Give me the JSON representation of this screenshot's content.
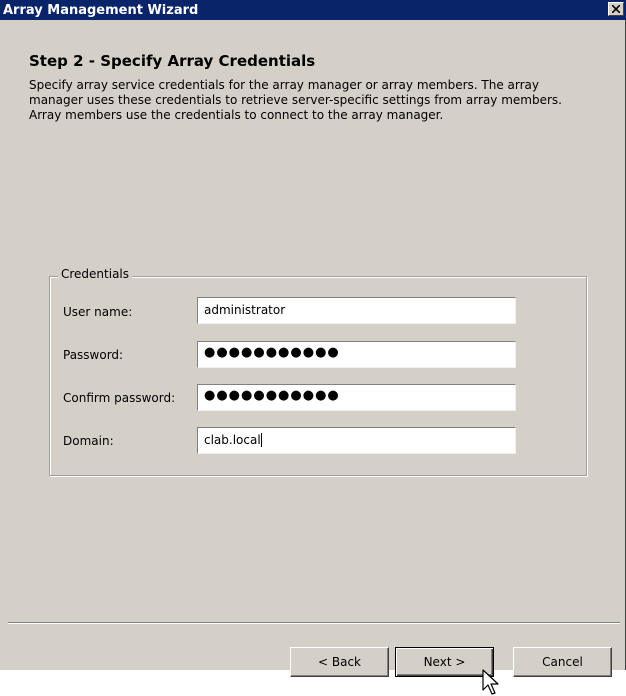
{
  "window": {
    "title": "Array Management Wizard"
  },
  "step": {
    "title": "Step 2 - Specify Array Credentials",
    "description": "Specify array service credentials for the array manager or array members. The array manager uses these credentials to retrieve server-specific settings from array members. Array members use the credentials to connect to the array manager."
  },
  "credentials": {
    "legend": "Credentials",
    "username_label": "User name:",
    "username_value": "administrator",
    "password_label": "Password:",
    "password_value": "●●●●●●●●●●●",
    "confirm_label": "Confirm password:",
    "confirm_value": "●●●●●●●●●●●",
    "domain_label": "Domain:",
    "domain_value": "clab.local"
  },
  "buttons": {
    "back": "< Back",
    "next": "Next >",
    "cancel": "Cancel"
  },
  "icons": {
    "close": "close-icon",
    "cursor": "mouse-pointer-icon"
  },
  "colors": {
    "titlebar": "#0a246a",
    "dialog_bg": "#d4d0c8"
  }
}
